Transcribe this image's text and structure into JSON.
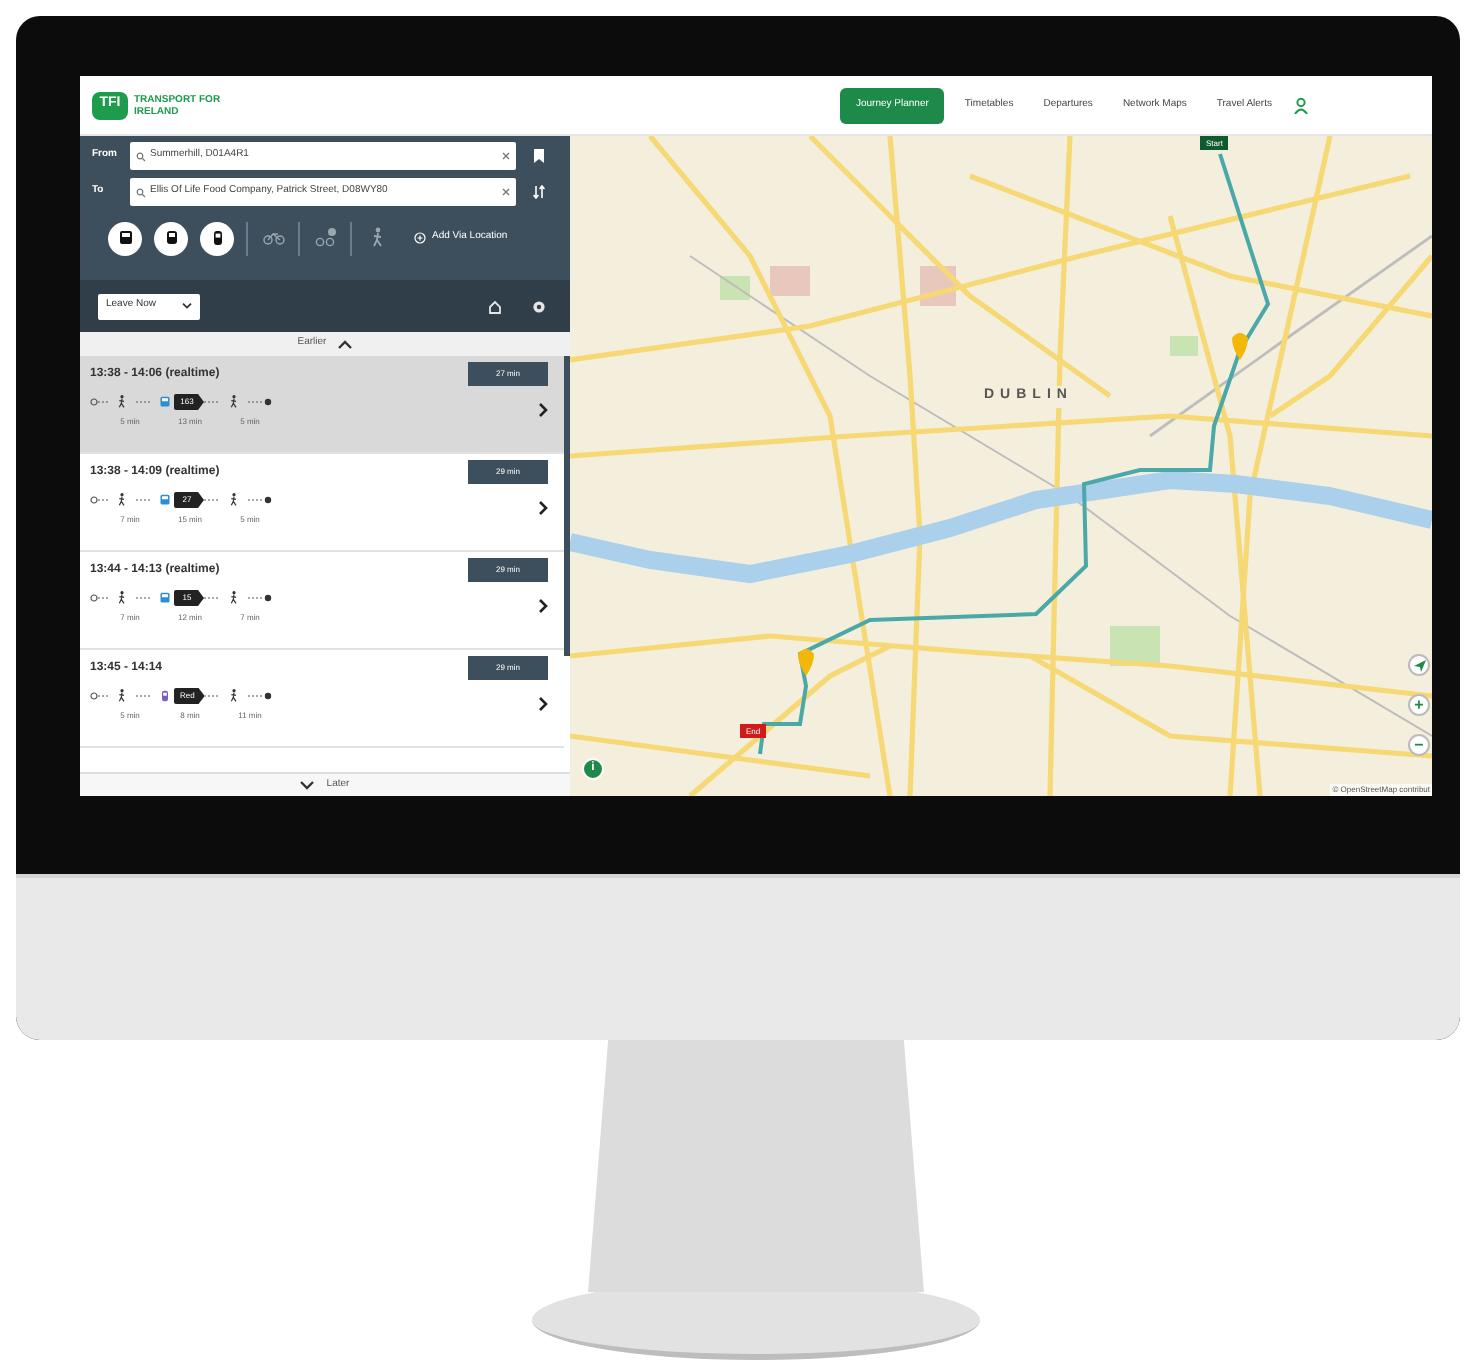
{
  "nav": {
    "logo": "TFI",
    "logo_caption": "TRANSPORT FOR IRELAND",
    "items": [
      {
        "label": "Journey Planner",
        "selected": true
      },
      {
        "label": "Timetables",
        "selected": false
      },
      {
        "label": "Departures",
        "selected": false
      },
      {
        "label": "Network Maps",
        "selected": false
      },
      {
        "label": "Travel Alerts",
        "selected": false
      }
    ]
  },
  "planner": {
    "from": {
      "label": "From",
      "value": "Summerhill, D01A4R1"
    },
    "to": {
      "label": "To",
      "value": "Ellis Of Life Food Company, Patrick Street, D08WY80"
    },
    "modes": [
      {
        "kind": "bus",
        "selected": true
      },
      {
        "kind": "train",
        "selected": true
      },
      {
        "kind": "tram",
        "selected": true
      },
      {
        "kind": "bike",
        "selected": false
      },
      {
        "kind": "bike_share",
        "selected": false
      },
      {
        "kind": "walk",
        "selected": false
      }
    ],
    "add_via": "Add Via Location",
    "time_option": "Leave Now"
  },
  "earlier": "Earlier",
  "journeys": [
    {
      "time": "13:38 - 14:06 (realtime)",
      "duration": "27 min",
      "selected": true,
      "legs": [
        {
          "kind": "walk",
          "duration": "5 min"
        },
        {
          "kind": "bus",
          "route": "163",
          "duration": "13 min"
        },
        {
          "kind": "walk",
          "duration": "5 min"
        }
      ]
    },
    {
      "time": "13:38 - 14:09 (realtime)",
      "duration": "29 min",
      "selected": false,
      "legs": [
        {
          "kind": "walk",
          "duration": "7 min"
        },
        {
          "kind": "bus",
          "route": "27",
          "duration": "15 min"
        },
        {
          "kind": "walk",
          "duration": "5 min"
        }
      ]
    },
    {
      "time": "13:44 - 14:13 (realtime)",
      "duration": "29 min",
      "selected": false,
      "legs": [
        {
          "kind": "walk",
          "duration": "7 min"
        },
        {
          "kind": "bus",
          "route": "15",
          "duration": "12 min"
        },
        {
          "kind": "walk",
          "duration": "7 min"
        }
      ]
    },
    {
      "time": "13:45 - 14:14",
      "duration": "29 min",
      "selected": false,
      "legs": [
        {
          "kind": "walk",
          "duration": "5 min"
        },
        {
          "kind": "tram",
          "route": "Red",
          "duration": "8 min"
        },
        {
          "kind": "walk",
          "duration": "11 min"
        }
      ]
    }
  ],
  "later": "Later",
  "map": {
    "city_label": "DUBLIN",
    "start_label": "Start",
    "end_label": "End",
    "zoom_in": "+",
    "zoom_out": "−",
    "info": "i",
    "attribution": "© OpenStreetMap contribut"
  }
}
